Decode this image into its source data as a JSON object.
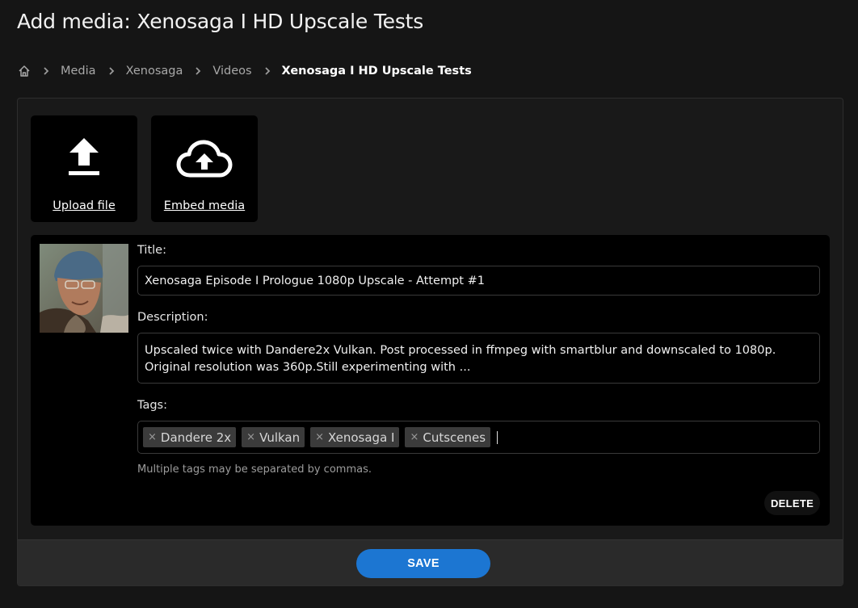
{
  "page": {
    "title": "Add media: Xenosaga I HD Upscale Tests"
  },
  "breadcrumb": {
    "home_icon": "home-icon",
    "items": [
      "Media",
      "Xenosaga",
      "Videos"
    ],
    "current": "Xenosaga I HD Upscale Tests"
  },
  "actions": {
    "upload": {
      "label": "Upload file",
      "icon": "upload-icon"
    },
    "embed": {
      "label": "Embed media",
      "icon": "cloud-upload-icon"
    }
  },
  "media": {
    "title_label": "Title:",
    "title_value": "Xenosaga Episode I Prologue 1080p Upscale - Attempt #1",
    "description_label": "Description:",
    "description_value": "Upscaled twice with Dandere2x Vulkan. Post processed in ffmpeg with smartblur and downscaled to 1080p. Original resolution was 360p.Still experimenting with ...",
    "tags_label": "Tags:",
    "tags": [
      "Dandere 2x",
      "Vulkan",
      "Xenosaga I",
      "Cutscenes"
    ],
    "tag_remove_glyph": "×",
    "tags_help": "Multiple tags may be separated by commas.",
    "delete_label": "DELETE"
  },
  "footer": {
    "save_label": "SAVE"
  },
  "colors": {
    "background": "#151515",
    "panel": "#191919",
    "card": "#000000",
    "accent": "#1c76d2",
    "tag_bg": "#3b3b3b"
  }
}
